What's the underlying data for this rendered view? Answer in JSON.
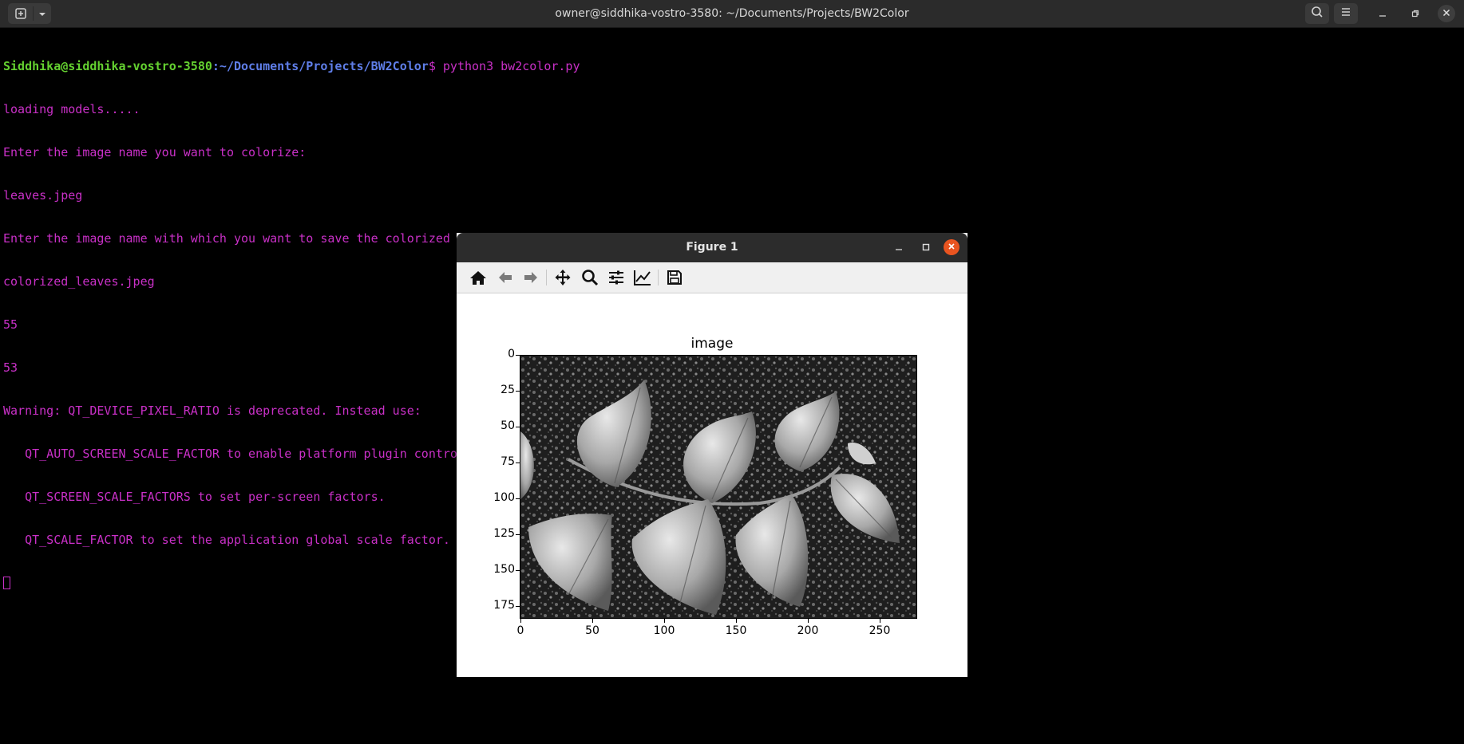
{
  "terminal": {
    "title": "owner@siddhika-vostro-3580: ~/Documents/Projects/BW2Color",
    "prompt_user": "Siddhika@siddhika-vostro-3580",
    "prompt_path": ":~/Documents/Projects/BW2Color",
    "prompt_symbol": "$ ",
    "command": "python3 bw2color.py",
    "output_lines": [
      "loading models.....",
      "Enter the image name you want to colorize:",
      "leaves.jpeg",
      "Enter the image name with which you want to save the colorized image:",
      "colorized_leaves.jpeg",
      "55",
      "53",
      "Warning: QT_DEVICE_PIXEL_RATIO is deprecated. Instead use:",
      "   QT_AUTO_SCREEN_SCALE_FACTOR to enable platform plugin controlled per-screen factors.",
      "   QT_SCREEN_SCALE_FACTORS to set per-screen factors.",
      "   QT_SCALE_FACTOR to set the application global scale factor."
    ],
    "colors": {
      "user": "#64d130",
      "path": "#5f7ee8",
      "text": "#c930c7"
    }
  },
  "figure": {
    "title": "Figure 1",
    "toolbar": [
      "home-icon",
      "back-icon",
      "forward-icon",
      "pan-icon",
      "zoom-icon",
      "configure-subplots-icon",
      "edit-axis-icon",
      "save-icon"
    ],
    "accent": "#e95420"
  },
  "chart_data": {
    "type": "image",
    "title": "image",
    "xlim": [
      0,
      275
    ],
    "ylim": [
      183,
      0
    ],
    "xticks": [
      "0",
      "50",
      "100",
      "150",
      "200",
      "250"
    ],
    "yticks": [
      "0",
      "25",
      "50",
      "75",
      "100",
      "125",
      "150",
      "175"
    ],
    "xtick_values": [
      0,
      50,
      100,
      150,
      200,
      250
    ],
    "ytick_values": [
      0,
      25,
      50,
      75,
      100,
      125,
      150,
      175
    ]
  }
}
